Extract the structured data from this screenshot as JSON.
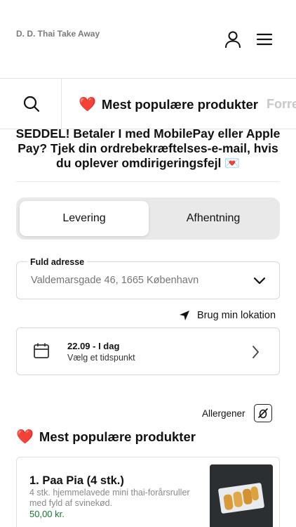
{
  "header": {
    "brand": "D. D. Thai Take Away",
    "user_icon": "user-icon",
    "menu_icon": "hamburger-menu-icon"
  },
  "category_bar": {
    "search_icon": "search-icon",
    "active": {
      "emoji": "❤️",
      "label": "Mest populære produkter"
    },
    "next": {
      "label": "Forret"
    }
  },
  "notice": {
    "text": "SEDDEL! Betaler I med MobilePay eller Apple Pay? Tjek din ordrebekræftelses-e-mail, hvis du oplever omdirigeringsfejl",
    "emoji": "💌"
  },
  "delivery_toggle": {
    "options": [
      "Levering",
      "Afhentning"
    ],
    "selected": "Levering"
  },
  "address": {
    "label": "Fuld adresse",
    "placeholder": "Valdemarsgade 46, 1665 København"
  },
  "location": {
    "label": "Brug min lokation",
    "icon": "location-arrow-icon"
  },
  "time": {
    "date": "22.09 - I dag",
    "subtitle": "Vælg et tidspunkt",
    "icon": "calendar-icon"
  },
  "allergen": {
    "label": "Allergener",
    "icon": "allergen-filter-icon"
  },
  "section": {
    "emoji": "❤️",
    "title": "Mest populære produkter"
  },
  "products": [
    {
      "name": "1. Paa Pia (4 stk.)",
      "description": "4 stk. hjemmelavede mini thai-forårsruller med fyld af svinekød.",
      "price": "50,00 kr."
    }
  ],
  "colors": {
    "price": "#0f7b2e",
    "heart": "#e0182d",
    "toggle_bg": "#e9e9e9",
    "muted_text": "#8a8a8a"
  }
}
